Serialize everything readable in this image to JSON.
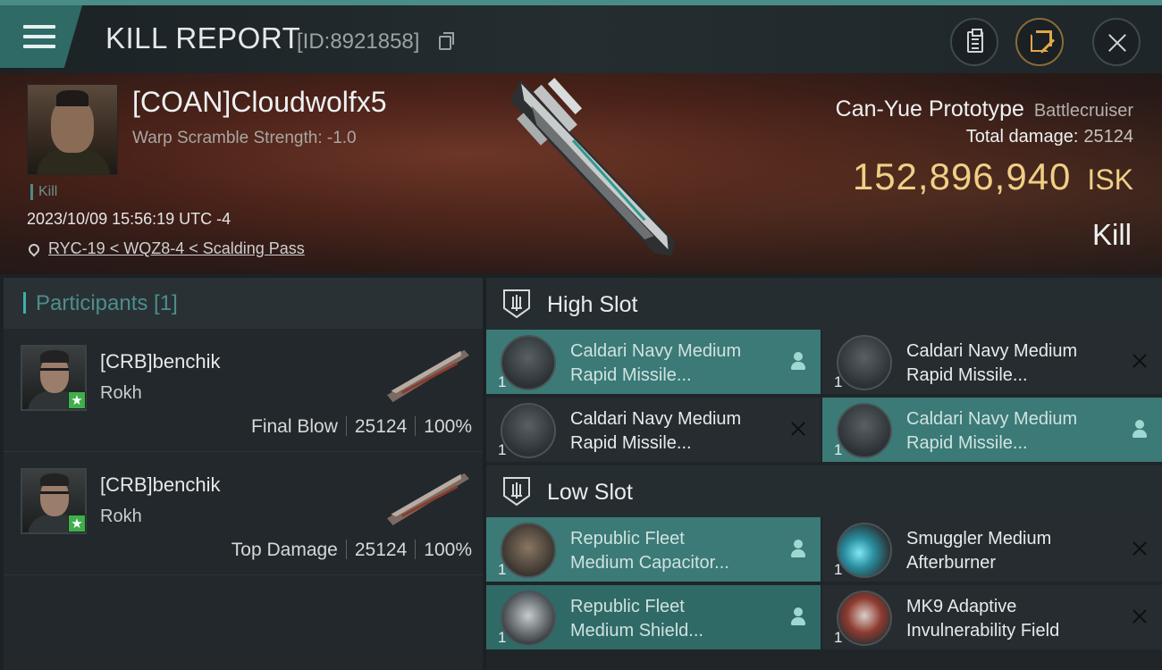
{
  "header": {
    "title": "KILL REPORT",
    "report_id": "[ID:8921858]"
  },
  "victim": {
    "name": "[COAN]Cloudwolfx5",
    "warp_scramble": "Warp Scramble Strength: -1.0",
    "tag": "Kill",
    "time": "2023/10/09 15:56:19 UTC -4",
    "location": "RYC-19 < WQZ8-4 < Scalding Pass"
  },
  "ship": {
    "name": "Can-Yue Prototype",
    "class": "Battlecruiser",
    "damage_label": "Total damage:",
    "damage_value": "25124",
    "isk_value": "152,896,940",
    "isk_unit": "ISK",
    "outcome": "Kill"
  },
  "participants": {
    "title": "Participants [1]",
    "rows": [
      {
        "name": "[CRB]benchik",
        "ship": "Rokh",
        "role": "Final Blow",
        "damage": "25124",
        "percent": "100%",
        "badge": "★"
      },
      {
        "name": "[CRB]benchik",
        "ship": "Rokh",
        "role": "Top Damage",
        "damage": "25124",
        "percent": "100%",
        "badge": "★"
      }
    ]
  },
  "fitting": {
    "high_slot": {
      "title": "High Slot",
      "modules": [
        {
          "qty": "1",
          "line1": "Caldari Navy Medium",
          "line2": "Rapid Missile...",
          "status": "dropped",
          "icon": "missile-launcher-icon"
        },
        {
          "qty": "1",
          "line1": "Caldari Navy Medium",
          "line2": "Rapid Missile...",
          "status": "destroyed",
          "icon": "missile-launcher-icon"
        },
        {
          "qty": "1",
          "line1": "Caldari Navy Medium",
          "line2": "Rapid Missile...",
          "status": "destroyed",
          "icon": "missile-launcher-icon"
        },
        {
          "qty": "1",
          "line1": "Caldari Navy Medium",
          "line2": "Rapid Missile...",
          "status": "dropped",
          "icon": "missile-launcher-icon"
        }
      ]
    },
    "low_slot": {
      "title": "Low Slot",
      "modules": [
        {
          "qty": "1",
          "line1": "Republic Fleet",
          "line2": "Medium Capacitor...",
          "status": "dropped",
          "icon": "capacitor-battery-icon"
        },
        {
          "qty": "1",
          "line1": "Smuggler Medium",
          "line2": "Afterburner",
          "status": "destroyed",
          "icon": "afterburner-icon"
        },
        {
          "qty": "1",
          "line1": "Republic Fleet",
          "line2": "Medium Shield...",
          "status": "dropped",
          "icon": "shield-icon"
        },
        {
          "qty": "1",
          "line1": "MK9 Adaptive",
          "line2": "Invulnerability Field",
          "status": "destroyed",
          "icon": "shield-invuln-icon"
        }
      ]
    }
  },
  "colors": {
    "accent": "#4a8c86",
    "isk": "#f0cf86",
    "fitted": "#3b7a76",
    "badge": "#3fae4b"
  }
}
